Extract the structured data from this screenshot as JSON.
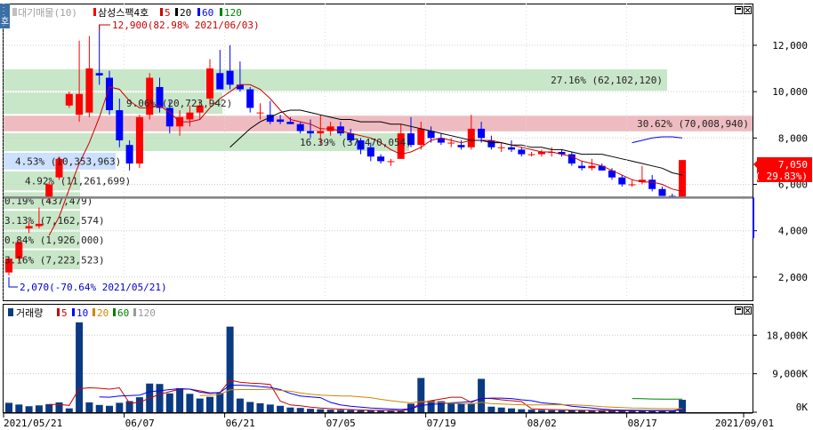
{
  "colors": {
    "up": "#ff0000",
    "down": "#0000ff",
    "volume_bar": "#0a3a82",
    "ma5": "#cc0000",
    "ma10": "#0000ff",
    "ma20": "#cc8800",
    "ma60": "#008000",
    "ma120": "#999999",
    "green_band": "#c8e6c8",
    "red_band": "#eebcc0",
    "blue_band": "#cce0ff",
    "current_line": "#808080"
  },
  "toolbar": {
    "side_tab": "호"
  },
  "price_panel": {
    "legend_main": "대기매물(10)",
    "legend_stock": "삼성스팩4호",
    "legend_ma": [
      "5",
      "20",
      "60",
      "120"
    ],
    "current_price": "7,050",
    "current_change": "( 29.83%)",
    "max_annotation": "12,900(82.98% 2021/06/03)",
    "min_annotation": "2,070(-70.64% 2021/05/21)"
  },
  "volume_panel": {
    "legend_main": "거래량",
    "legend_ma": [
      "5",
      "10",
      "20",
      "60",
      "120"
    ]
  },
  "chart_data": [
    {
      "type": "candlestick",
      "title": "삼성스팩4호",
      "ylim": [
        1000,
        13800
      ],
      "yticks": [
        2000,
        4000,
        6000,
        8000,
        10000,
        12000
      ],
      "ytick_labels": [
        "2,000",
        "4,000",
        "6,000",
        "8,000",
        "10,000",
        "12,000"
      ],
      "current_price_line": 5430,
      "supply_bands": [
        {
          "low": 10000,
          "high": 11000,
          "label": "27.16% (62,102,120)",
          "color": "green"
        },
        {
          "low": 9000,
          "high": 10000,
          "label": "9.06% (20,723,942)",
          "color": "green"
        },
        {
          "low": 8250,
          "high": 9000,
          "label": "30.62% (70,008,940)",
          "color": "red"
        },
        {
          "low": 7400,
          "high": 8250,
          "label": "16.39% (37,470,054)",
          "color": "green"
        },
        {
          "low": 6600,
          "high": 7400,
          "label": "4.53% (10,353,963)",
          "color": "blue"
        },
        {
          "low": 5700,
          "high": 6600,
          "label": "4.92% (11,261,699)",
          "color": "green"
        },
        {
          "low": 4900,
          "high": 5700,
          "label": "0.19% (437,479)",
          "color": "green"
        },
        {
          "low": 4000,
          "high": 4900,
          "label": "3.13% (7,162,574)",
          "color": "green"
        },
        {
          "low": 3200,
          "high": 4000,
          "label": "0.84% (1,926,000)",
          "color": "green"
        },
        {
          "low": 2300,
          "high": 3200,
          "label": "3.16% (7,223,523)",
          "color": "green"
        }
      ],
      "x_labels": [
        "2021/05/21",
        "06/07",
        "06/21",
        "07/05",
        "07/19",
        "08/02",
        "08/17",
        "2021/09/01"
      ],
      "x_label_index": [
        0,
        12,
        22,
        32,
        42,
        52,
        62,
        72
      ],
      "candles": [
        {
          "o": 2200,
          "h": 2900,
          "l": 2070,
          "c": 2800
        },
        {
          "o": 2800,
          "h": 3600,
          "l": 2700,
          "c": 3500
        },
        {
          "o": 4100,
          "h": 4400,
          "l": 3900,
          "c": 4200
        },
        {
          "o": 4200,
          "h": 5000,
          "l": 4100,
          "c": 4300
        },
        {
          "o": 5400,
          "h": 6100,
          "l": 5200,
          "c": 6000
        },
        {
          "o": 6300,
          "h": 7200,
          "l": 6200,
          "c": 7100
        },
        {
          "o": 9400,
          "h": 10000,
          "l": 9300,
          "c": 9900
        },
        {
          "o": 9000,
          "h": 12200,
          "l": 8700,
          "c": 9900
        },
        {
          "o": 9100,
          "h": 12400,
          "l": 8900,
          "c": 11000
        },
        {
          "o": 10800,
          "h": 12900,
          "l": 10300,
          "c": 10700
        },
        {
          "o": 10600,
          "h": 10900,
          "l": 9000,
          "c": 9200
        },
        {
          "o": 9200,
          "h": 9700,
          "l": 7600,
          "c": 7900
        },
        {
          "o": 7700,
          "h": 7900,
          "l": 6600,
          "c": 6900
        },
        {
          "o": 6900,
          "h": 9000,
          "l": 6700,
          "c": 8900
        },
        {
          "o": 9000,
          "h": 10800,
          "l": 8800,
          "c": 10600
        },
        {
          "o": 10200,
          "h": 10600,
          "l": 9100,
          "c": 9300
        },
        {
          "o": 9300,
          "h": 9600,
          "l": 8200,
          "c": 8500
        },
        {
          "o": 8500,
          "h": 9200,
          "l": 8100,
          "c": 8900
        },
        {
          "o": 8800,
          "h": 9400,
          "l": 8500,
          "c": 9100
        },
        {
          "o": 9100,
          "h": 9600,
          "l": 8800,
          "c": 9400
        },
        {
          "o": 9700,
          "h": 11400,
          "l": 9400,
          "c": 11000
        },
        {
          "o": 10800,
          "h": 11800,
          "l": 10100,
          "c": 10100
        },
        {
          "o": 10900,
          "h": 12000,
          "l": 10100,
          "c": 10300
        },
        {
          "o": 10300,
          "h": 11300,
          "l": 10000,
          "c": 10100
        },
        {
          "o": 10100,
          "h": 10200,
          "l": 9100,
          "c": 9300
        },
        {
          "o": 9100,
          "h": 9500,
          "l": 8800,
          "c": 9100
        },
        {
          "o": 9000,
          "h": 9600,
          "l": 8600,
          "c": 8700
        },
        {
          "o": 8800,
          "h": 9000,
          "l": 8600,
          "c": 8700
        },
        {
          "o": 8700,
          "h": 8900,
          "l": 8600,
          "c": 8600
        },
        {
          "o": 8600,
          "h": 8700,
          "l": 8200,
          "c": 8300
        },
        {
          "o": 8300,
          "h": 8800,
          "l": 8000,
          "c": 8200
        },
        {
          "o": 8200,
          "h": 9000,
          "l": 7700,
          "c": 8300
        },
        {
          "o": 8300,
          "h": 8700,
          "l": 8100,
          "c": 8500
        },
        {
          "o": 8500,
          "h": 8700,
          "l": 8100,
          "c": 8200
        },
        {
          "o": 8200,
          "h": 8400,
          "l": 7800,
          "c": 7900
        },
        {
          "o": 7900,
          "h": 8000,
          "l": 7300,
          "c": 7500
        },
        {
          "o": 7600,
          "h": 7800,
          "l": 7000,
          "c": 7200
        },
        {
          "o": 7200,
          "h": 7300,
          "l": 6900,
          "c": 7000
        },
        {
          "o": 7000,
          "h": 7100,
          "l": 6800,
          "c": 7000
        },
        {
          "o": 7100,
          "h": 8600,
          "l": 7100,
          "c": 8200
        },
        {
          "o": 8200,
          "h": 8900,
          "l": 7600,
          "c": 7700
        },
        {
          "o": 7700,
          "h": 8700,
          "l": 7500,
          "c": 8400
        },
        {
          "o": 8300,
          "h": 8500,
          "l": 7800,
          "c": 8000
        },
        {
          "o": 8000,
          "h": 8200,
          "l": 7700,
          "c": 7800
        },
        {
          "o": 7800,
          "h": 8000,
          "l": 7600,
          "c": 7800
        },
        {
          "o": 7700,
          "h": 7900,
          "l": 7500,
          "c": 7600
        },
        {
          "o": 7600,
          "h": 9000,
          "l": 7500,
          "c": 8400
        },
        {
          "o": 8400,
          "h": 8700,
          "l": 7800,
          "c": 8000
        },
        {
          "o": 7900,
          "h": 8100,
          "l": 7500,
          "c": 7600
        },
        {
          "o": 7600,
          "h": 7800,
          "l": 7400,
          "c": 7600
        },
        {
          "o": 7600,
          "h": 7900,
          "l": 7400,
          "c": 7500
        },
        {
          "o": 7500,
          "h": 7600,
          "l": 7200,
          "c": 7300
        },
        {
          "o": 7300,
          "h": 7400,
          "l": 7200,
          "c": 7300
        },
        {
          "o": 7300,
          "h": 7500,
          "l": 7200,
          "c": 7400
        },
        {
          "o": 7400,
          "h": 7600,
          "l": 7200,
          "c": 7400
        },
        {
          "o": 7400,
          "h": 7500,
          "l": 7200,
          "c": 7300
        },
        {
          "o": 7300,
          "h": 7400,
          "l": 6800,
          "c": 6900
        },
        {
          "o": 6800,
          "h": 7000,
          "l": 6600,
          "c": 6700
        },
        {
          "o": 6700,
          "h": 7100,
          "l": 6600,
          "c": 6800
        },
        {
          "o": 6800,
          "h": 6900,
          "l": 6600,
          "c": 6600
        },
        {
          "o": 6600,
          "h": 6700,
          "l": 6200,
          "c": 6300
        },
        {
          "o": 6300,
          "h": 6400,
          "l": 5900,
          "c": 6000
        },
        {
          "o": 6000,
          "h": 6200,
          "l": 5900,
          "c": 6000
        },
        {
          "o": 6100,
          "h": 6800,
          "l": 6000,
          "c": 6200
        },
        {
          "o": 6200,
          "h": 6400,
          "l": 5700,
          "c": 5800
        },
        {
          "o": 5800,
          "h": 5900,
          "l": 5500,
          "c": 5500
        },
        {
          "o": 5500,
          "h": 5600,
          "l": 5400,
          "c": 5400
        },
        {
          "o": 5430,
          "h": 7050,
          "l": 5430,
          "c": 7050
        }
      ],
      "ma5": [
        null,
        null,
        null,
        null,
        3800,
        4600,
        5800,
        6900,
        7800,
        8900,
        10200,
        10100,
        9600,
        9300,
        9300,
        9400,
        9100,
        8700,
        8700,
        8800,
        9300,
        9700,
        10000,
        10300,
        10300,
        10100,
        9700,
        9200,
        8800,
        8700,
        8600,
        8400,
        8400,
        8300,
        8200,
        8100,
        8000,
        7800,
        7500,
        7300,
        7400,
        7600,
        7900,
        8000,
        7900,
        7800,
        7900,
        7900,
        7900,
        7800,
        7700,
        7600,
        7500,
        7400,
        7400,
        7300,
        7200,
        7000,
        6900,
        6800,
        6600,
        6400,
        6200,
        6100,
        6100,
        6000,
        5800,
        5700
      ],
      "ma20": [
        null,
        null,
        null,
        null,
        null,
        null,
        null,
        null,
        null,
        null,
        null,
        null,
        null,
        null,
        null,
        null,
        null,
        null,
        null,
        null,
        null,
        null,
        7600,
        8000,
        8400,
        8700,
        8900,
        9100,
        9200,
        9200,
        9100,
        9000,
        8900,
        8800,
        8800,
        8700,
        8700,
        8700,
        8600,
        8600,
        8500,
        8400,
        8300,
        8200,
        8100,
        8000,
        7900,
        7900,
        7800,
        7800,
        7700,
        7700,
        7600,
        7600,
        7500,
        7500,
        7400,
        7300,
        7300,
        7300,
        7200,
        7100,
        7000,
        6900,
        6800,
        6700,
        6500,
        6400
      ],
      "ma60": [
        null,
        null,
        null,
        null,
        null,
        null,
        null,
        null,
        null,
        null,
        null,
        null,
        null,
        null,
        null,
        null,
        null,
        null,
        null,
        null,
        null,
        null,
        null,
        null,
        null,
        null,
        null,
        null,
        null,
        null,
        null,
        null,
        null,
        null,
        null,
        null,
        null,
        null,
        null,
        null,
        null,
        null,
        null,
        null,
        null,
        null,
        null,
        null,
        null,
        null,
        null,
        null,
        null,
        null,
        null,
        null,
        null,
        null,
        null,
        null,
        null,
        null,
        7800,
        7900,
        8000,
        8050,
        8050,
        8000
      ],
      "ma60_color": "blue"
    },
    {
      "type": "bar",
      "title": "거래량",
      "ylim": [
        0,
        22000
      ],
      "yticks": [
        0,
        9000,
        18000
      ],
      "ytick_labels": [
        "0K",
        "9,000K",
        "18,000K"
      ],
      "values": [
        2200,
        1800,
        1400,
        1600,
        1900,
        2300,
        900,
        21000,
        2300,
        1700,
        1500,
        2200,
        2600,
        3500,
        6700,
        6600,
        4400,
        5600,
        4300,
        3200,
        3600,
        4500,
        20000,
        3200,
        2400,
        2100,
        1800,
        1500,
        1100,
        1000,
        800,
        700,
        600,
        550,
        500,
        420,
        400,
        380,
        360,
        330,
        2000,
        8000,
        2700,
        2600,
        2200,
        2000,
        2100,
        7800,
        1300,
        1100,
        900,
        700,
        600,
        520,
        480,
        460,
        420,
        410,
        400,
        390,
        380,
        360,
        350,
        340,
        330,
        320,
        330,
        2900
      ],
      "ma5": [
        null,
        null,
        null,
        null,
        1800,
        1800,
        1600,
        5500,
        5700,
        5600,
        5400,
        5700,
        2100,
        2300,
        3300,
        4200,
        4800,
        5400,
        5400,
        5000,
        4500,
        4600,
        7500,
        7000,
        6800,
        6700,
        6500,
        2600,
        1700,
        1500,
        1200,
        1000,
        850,
        720,
        630,
        540,
        480,
        440,
        410,
        380,
        720,
        2200,
        2700,
        3100,
        3500,
        3500,
        2300,
        3300,
        3200,
        2900,
        2700,
        2500,
        800,
        700,
        630,
        560,
        500,
        460,
        430,
        410,
        400,
        380,
        370,
        355,
        340,
        330,
        330,
        840
      ],
      "ma10": [
        null,
        null,
        null,
        null,
        null,
        null,
        null,
        null,
        null,
        3600,
        3500,
        3800,
        3900,
        4000,
        4800,
        5000,
        5300,
        5500,
        5400,
        4700,
        4400,
        4600,
        6300,
        6300,
        6200,
        6000,
        5800,
        5300,
        4400,
        3800,
        3600,
        3400,
        2300,
        1700,
        1400,
        1200,
        1000,
        870,
        750,
        650,
        800,
        1600,
        1800,
        2000,
        2200,
        2300,
        2500,
        3200,
        3300,
        3300,
        3200,
        2900,
        2700,
        2200,
        2000,
        1800,
        1400,
        1200,
        1000,
        720,
        580,
        500,
        460,
        440,
        420,
        410,
        400,
        520
      ],
      "ma20": [
        null,
        null,
        null,
        null,
        null,
        null,
        null,
        null,
        null,
        null,
        null,
        null,
        null,
        null,
        null,
        null,
        null,
        null,
        null,
        3900,
        4000,
        4200,
        5200,
        5300,
        5300,
        5300,
        5400,
        5100,
        4900,
        4500,
        4200,
        4000,
        3900,
        3800,
        3800,
        3600,
        3400,
        3000,
        2700,
        2400,
        2200,
        2500,
        2400,
        2300,
        2100,
        2000,
        1900,
        2300,
        2000,
        1900,
        1800,
        1750,
        1700,
        1700,
        1750,
        1750,
        1750,
        1650,
        1500,
        1300,
        1200,
        1100,
        1000,
        950,
        900,
        860,
        820,
        800
      ],
      "ma60": [
        null,
        null,
        null,
        null,
        null,
        null,
        null,
        null,
        null,
        null,
        null,
        null,
        null,
        null,
        null,
        null,
        null,
        null,
        null,
        null,
        null,
        null,
        null,
        null,
        null,
        null,
        null,
        null,
        null,
        null,
        null,
        null,
        null,
        null,
        null,
        null,
        null,
        null,
        null,
        null,
        null,
        null,
        null,
        null,
        null,
        null,
        null,
        null,
        null,
        null,
        null,
        null,
        null,
        null,
        null,
        null,
        null,
        null,
        null,
        null,
        null,
        null,
        3200,
        3150,
        3100,
        3080,
        3050,
        3050
      ]
    }
  ]
}
